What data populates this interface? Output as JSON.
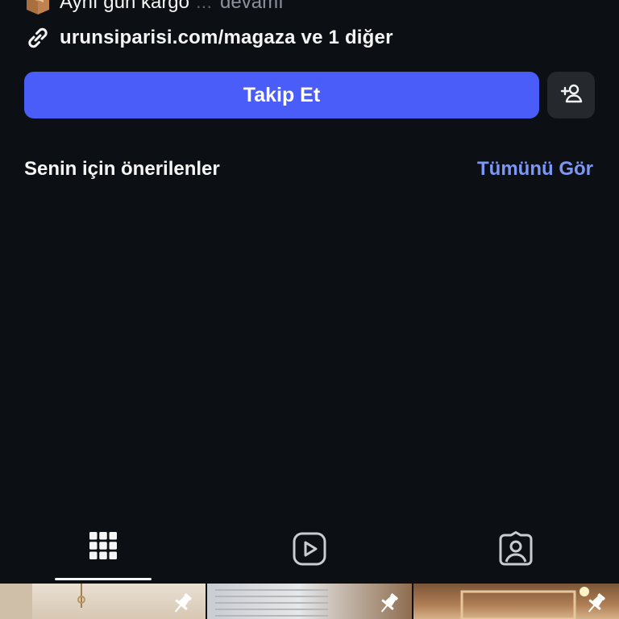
{
  "bio": {
    "line1_text": "Aynı gün kargo",
    "line1_dots": "...",
    "line1_more": "devamı",
    "link_text": "urunsiparisi.com/magaza ve 1 diğer"
  },
  "actions": {
    "follow_label": "Takip Et",
    "add_user_icon": "add-user-icon"
  },
  "suggestions": {
    "title": "Senin için önerilenler",
    "see_all_label": "Tümünü Gör"
  },
  "tabs": [
    {
      "icon": "grid-icon",
      "active": true
    },
    {
      "icon": "reels-icon",
      "active": false
    },
    {
      "icon": "tagged-icon",
      "active": false
    }
  ],
  "posts": [
    {
      "pinned": true
    },
    {
      "pinned": true
    },
    {
      "pinned": true
    }
  ],
  "colors": {
    "background": "#0c1014",
    "primary_button": "#4a5df9",
    "secondary_button": "#25292e",
    "link_accent": "#7d97f2",
    "muted_text": "#8c929b"
  }
}
